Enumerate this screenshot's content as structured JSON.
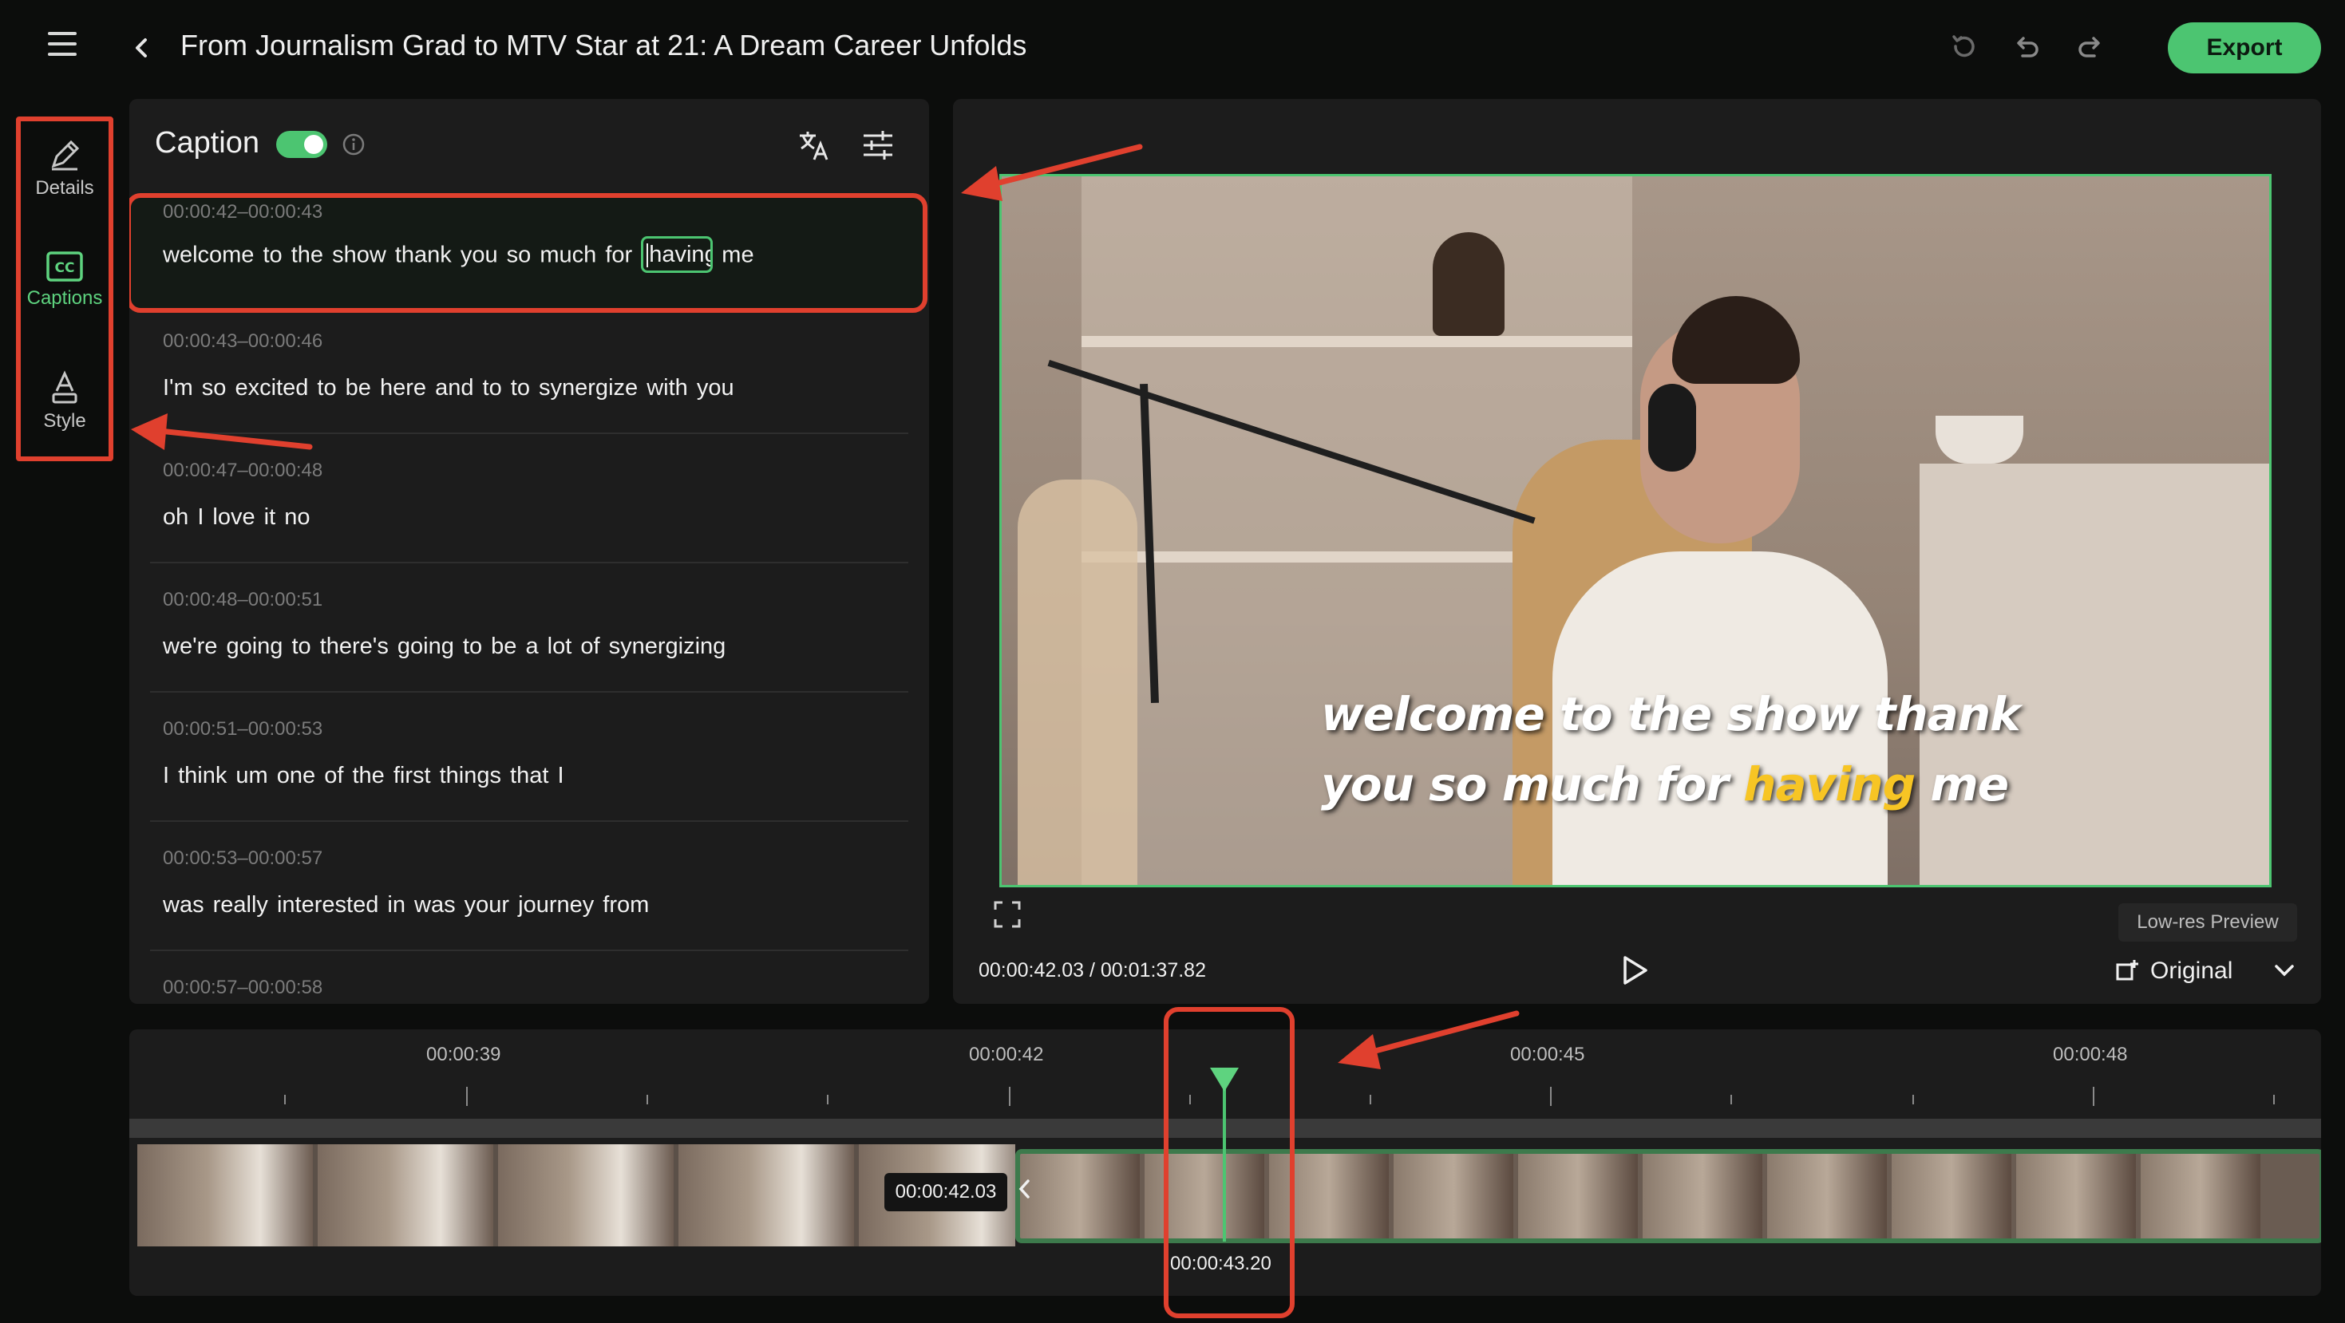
{
  "header": {
    "title": "From Journalism Grad to MTV Star at 21: A Dream Career Unfolds",
    "export_label": "Export"
  },
  "rail": {
    "items": [
      {
        "label": "Details",
        "icon": "pencil-icon"
      },
      {
        "label": "Captions",
        "icon": "cc-icon",
        "active": true
      },
      {
        "label": "Style",
        "icon": "style-icon"
      }
    ]
  },
  "caption_panel": {
    "title": "Caption",
    "toggle_on": true,
    "items": [
      {
        "time": "00:00:42–00:00:43",
        "text_before": "welcome to the show thank you so much for",
        "edit_word": "having",
        "text_after": "me"
      },
      {
        "time": "00:00:43–00:00:46",
        "text": "I'm so excited to be here and to to synergize with you"
      },
      {
        "time": "00:00:47–00:00:48",
        "text": "oh I love it no"
      },
      {
        "time": "00:00:48–00:00:51",
        "text": "we're going to there's going to be a lot of synergizing"
      },
      {
        "time": "00:00:51–00:00:53",
        "text": "I think um one of the first things that I"
      },
      {
        "time": "00:00:53–00:00:57",
        "text": "was really interested in was your journey from"
      },
      {
        "time": "00:00:57–00:00:58",
        "text": ""
      }
    ]
  },
  "preview": {
    "subtitle_line1": "welcome to the show thank",
    "subtitle_line2_before": "you so much for",
    "subtitle_highlight": "having",
    "subtitle_line2_after": "me",
    "lowres_label": "Low-res Preview",
    "timecode": "00:00:42.03 / 00:01:37.82",
    "ratio_label": "Original"
  },
  "timeline": {
    "labels": [
      "00:00:39",
      "00:00:42",
      "00:00:45",
      "00:00:48"
    ],
    "clip_start_badge": "00:00:42.03",
    "playhead_time": "00:00:43.20"
  },
  "colors": {
    "accent": "#4cc571",
    "annotation": "#e0402e",
    "subtitle_highlight": "#f7c524"
  }
}
